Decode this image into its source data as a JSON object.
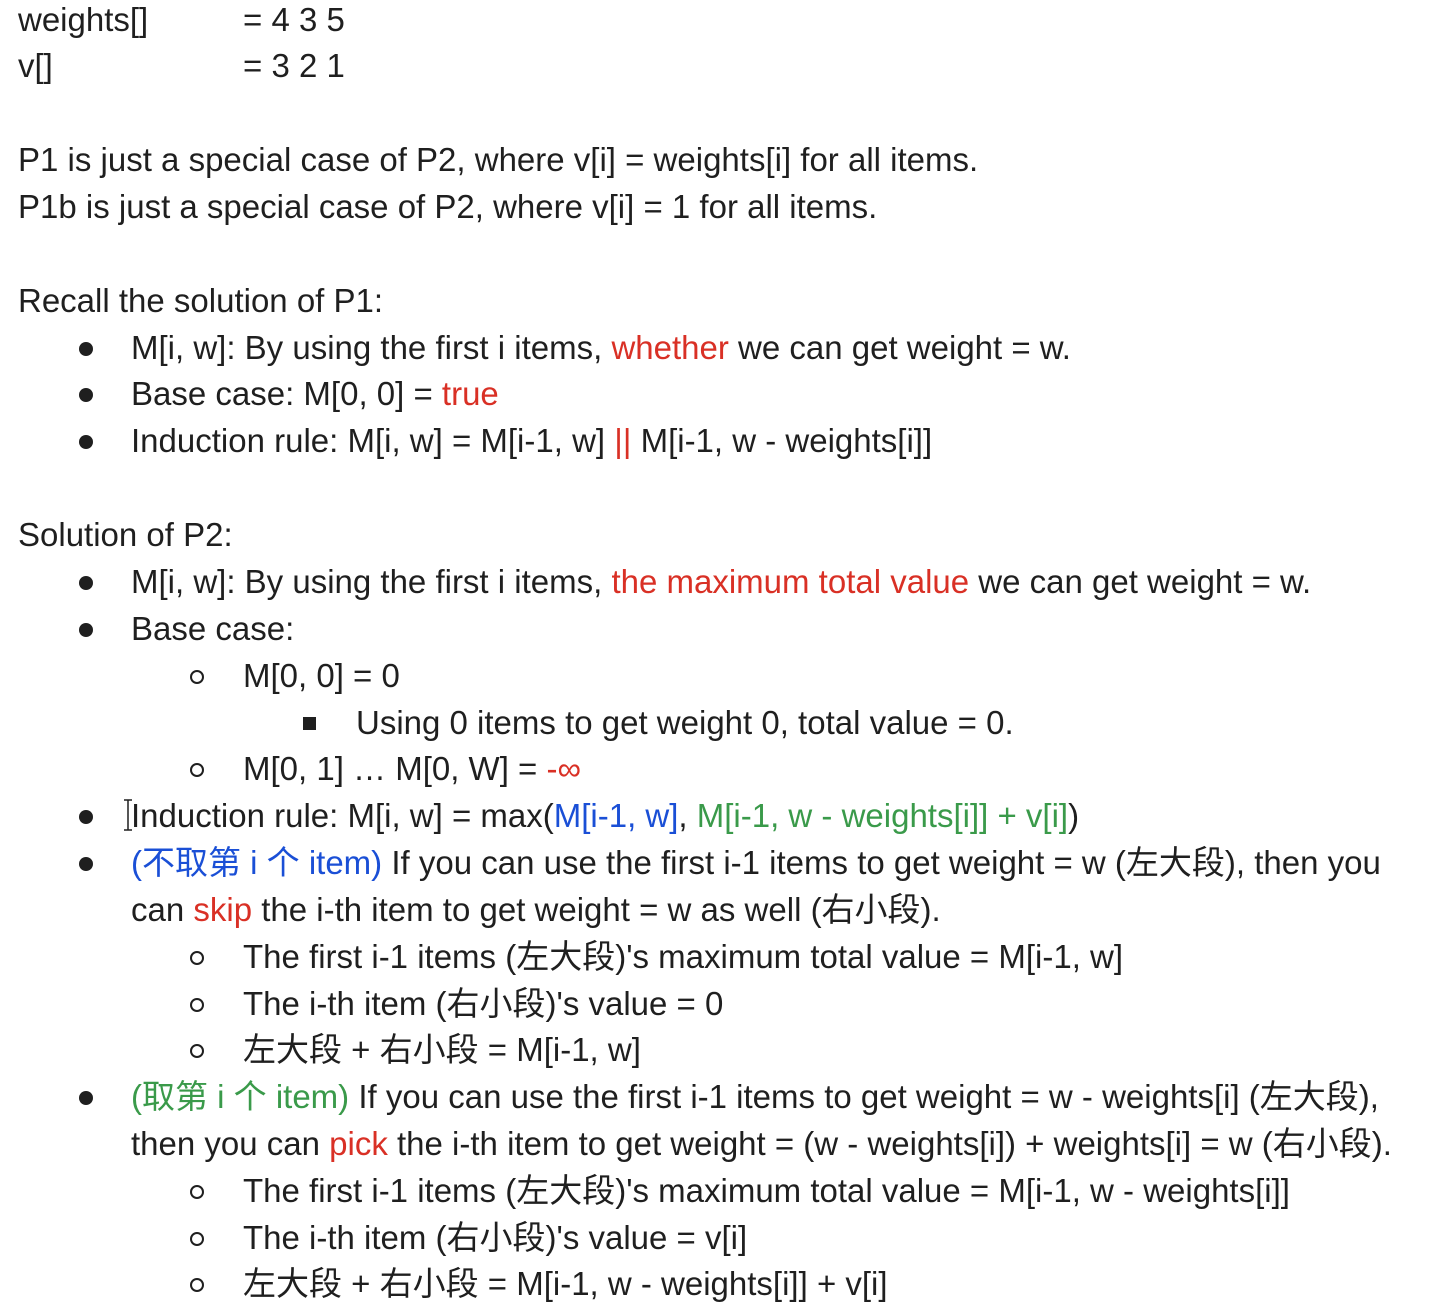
{
  "header": {
    "weights_label": "weights[]",
    "weights_value": "= 4 3 5",
    "v_label": "v[]",
    "v_value": "= 3 2 1"
  },
  "special_cases": {
    "p1": "P1 is just a special case of P2, where v[i] = weights[i] for all items.",
    "p1b": "P1b is just a special case of P2, where v[i] = 1 for all items."
  },
  "recall": {
    "heading": "Recall the solution of P1:",
    "item1_pre": "M[i, w]: By using the first i items, ",
    "item1_hl": "whether",
    "item1_post": " we can get weight = w.",
    "item2_pre": "Base case: M[0, 0] = ",
    "item2_hl": "true",
    "item3_pre": "Induction rule: M[i, w] = M[i-1, w] ",
    "item3_hl": "||",
    "item3_post": " M[i-1, w - weights[i]]"
  },
  "solution": {
    "heading": "Solution of P2:",
    "item1_pre": "M[i, w]: By using the first i items, ",
    "item1_hl": "the maximum total value",
    "item1_post": " we can get weight = w.",
    "base_case": "Base case:",
    "sub1": "M[0, 0] = 0",
    "sub1_detail": "Using 0 items to get weight 0, total value = 0.",
    "sub2_pre": "M[0, 1] … M[0, W] = ",
    "sub2_hl": "-∞",
    "induction_pre": "Induction rule: M[i, w] = max(",
    "induction_blue": "M[i-1, w]",
    "induction_sep": ", ",
    "induction_green": "M[i-1, w - weights[i]] + v[i]",
    "induction_post": ")",
    "skip_tag": "(不取第 i 个 item)",
    "skip_line1": " If you can use the first i-1 items to get weight = w (左大段), then you",
    "skip_line2_pre": "can ",
    "skip_word": "skip",
    "skip_line2_post": " the i-th item to get weight = w as well (右小段).",
    "skip_sub1": "The first i-1 items (左大段)'s maximum total value = M[i-1, w]",
    "skip_sub2": "The i-th item (右小段)'s value = 0",
    "skip_sub3": "左大段 + 右小段 = M[i-1, w]",
    "pick_tag": "(取第 i 个 item)",
    "pick_line1": " If you can use the first i-1 items to get weight = w - weights[i] (左大段),",
    "pick_line2_pre": "then you can ",
    "pick_word": "pick",
    "pick_line2_post": " the i-th item to get weight = (w - weights[i]) + weights[i] = w (右小段).",
    "pick_sub1": "The first i-1 items (左大段)'s maximum total value = M[i-1, w - weights[i]]",
    "pick_sub2": "The i-th item (右小段)'s value = v[i]",
    "pick_sub3": "左大段 + 右小段 = M[i-1, w - weights[i]] + v[i]"
  },
  "colors": {
    "red": "#d93025",
    "blue": "#1a4fd6",
    "green": "#3a9a4a"
  }
}
